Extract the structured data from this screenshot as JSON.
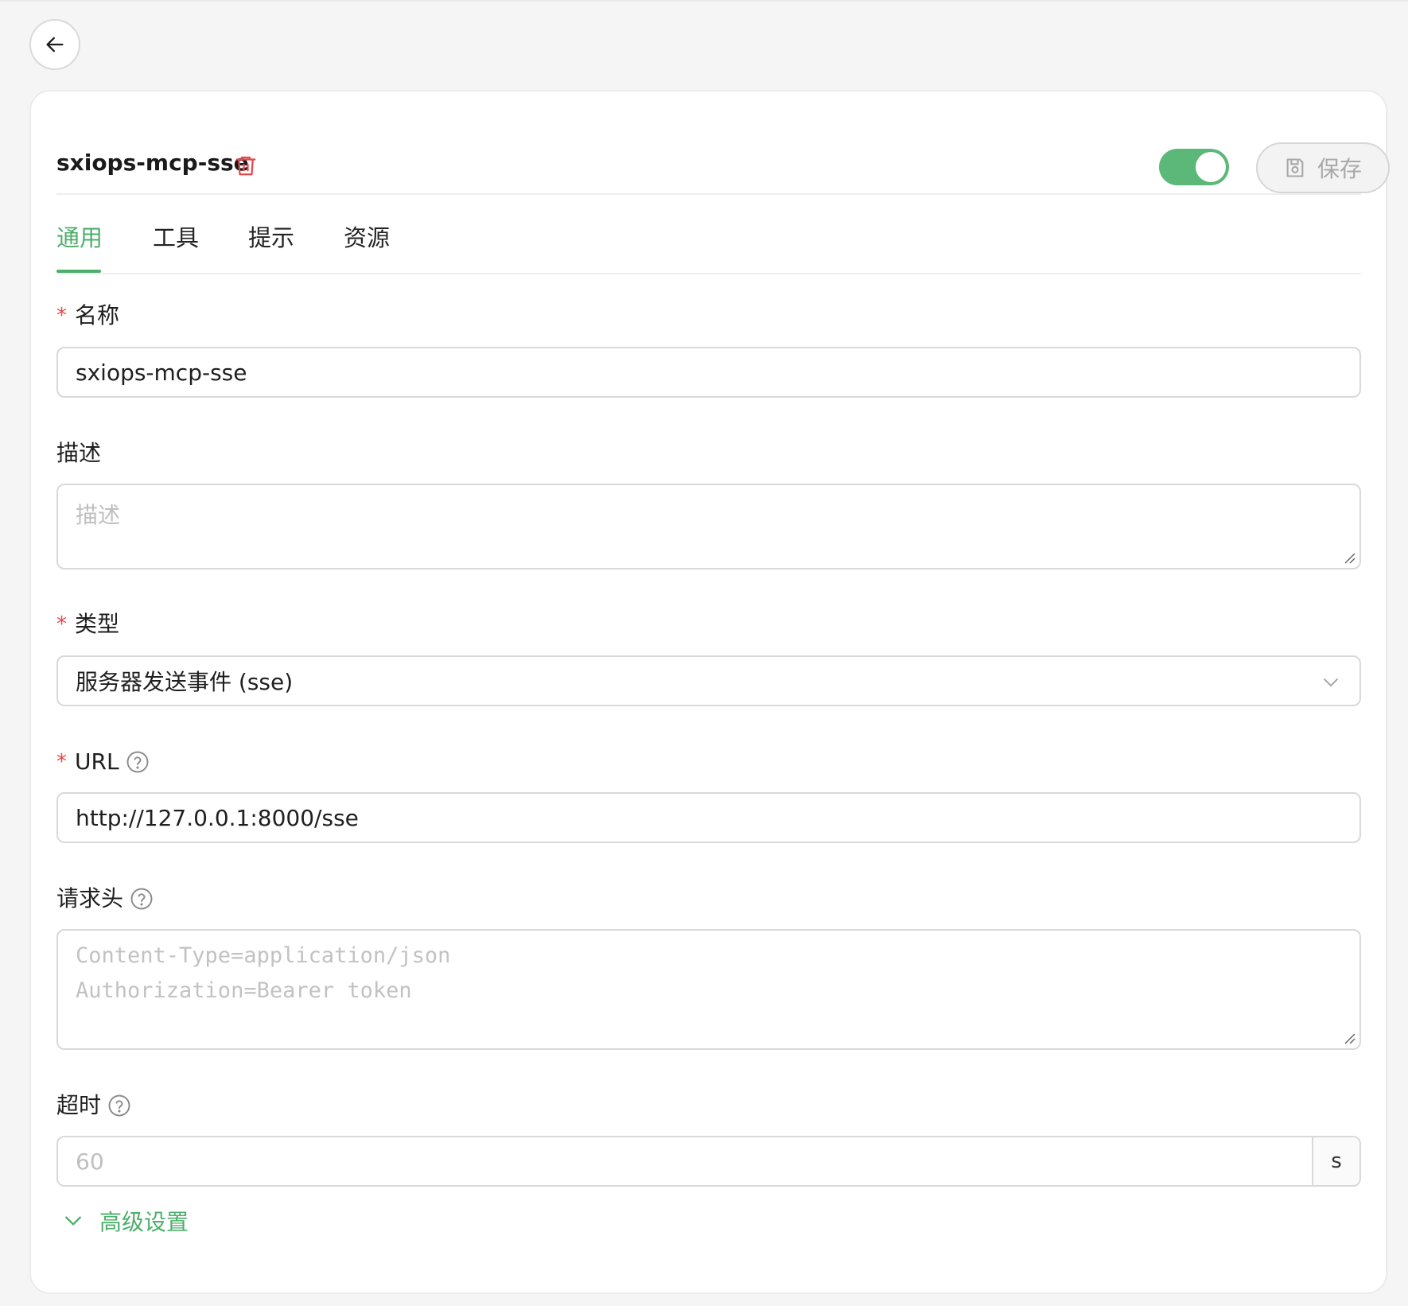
{
  "header": {
    "title": "sxiops-mcp-sse",
    "enabled": true,
    "save_label": "保存"
  },
  "tabs": [
    {
      "label": "通用",
      "active": true
    },
    {
      "label": "工具",
      "active": false
    },
    {
      "label": "提示",
      "active": false
    },
    {
      "label": "资源",
      "active": false
    }
  ],
  "form": {
    "name": {
      "label": "名称",
      "required": true,
      "value": "sxiops-mcp-sse"
    },
    "description": {
      "label": "描述",
      "placeholder": "描述",
      "value": ""
    },
    "type": {
      "label": "类型",
      "required": true,
      "value": "服务器发送事件 (sse)"
    },
    "url": {
      "label": "URL",
      "required": true,
      "value": "http://127.0.0.1:8000/sse"
    },
    "headers": {
      "label": "请求头",
      "placeholder": "Content-Type=application/json\nAuthorization=Bearer token",
      "value": ""
    },
    "timeout": {
      "label": "超时",
      "placeholder": "60",
      "suffix": "s"
    },
    "advanced_label": "高级设置"
  },
  "colors": {
    "accent": "#4caf6a",
    "danger": "#e5484d",
    "toggle_on": "#5cb878"
  },
  "icons": {
    "back": "arrow-left-icon",
    "delete": "trash-icon",
    "save": "save-disk-icon",
    "help": "question-circle-icon",
    "select": "chevron-down-icon",
    "advanced": "chevron-down-icon"
  }
}
